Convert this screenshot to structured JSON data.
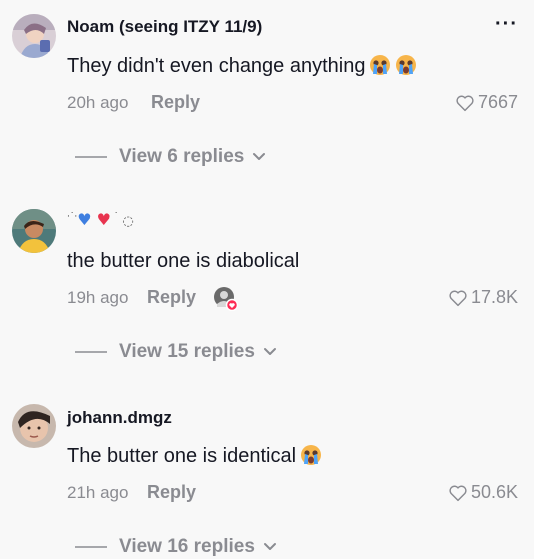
{
  "comments": [
    {
      "author": "Noam (seeing ITZY 11/9)",
      "text": "They didn't even change anything",
      "time": "20h ago",
      "reply_label": "Reply",
      "likes": "7667",
      "view_replies": "View 6 replies",
      "more": "···"
    },
    {
      "author": "",
      "text": "the butter one is diabolical",
      "time": "19h ago",
      "reply_label": "Reply",
      "likes": "17.8K",
      "view_replies": "View 15 replies"
    },
    {
      "author": "johann.dmgz",
      "text": "The butter one is identical",
      "time": "21h ago",
      "reply_label": "Reply",
      "likes": "50.6K",
      "view_replies": "View 16 replies"
    }
  ],
  "colors": {
    "background": "#f8f8f8",
    "text_primary": "#161823",
    "text_secondary": "#8a8b91",
    "liked_red": "#fe2c55"
  }
}
